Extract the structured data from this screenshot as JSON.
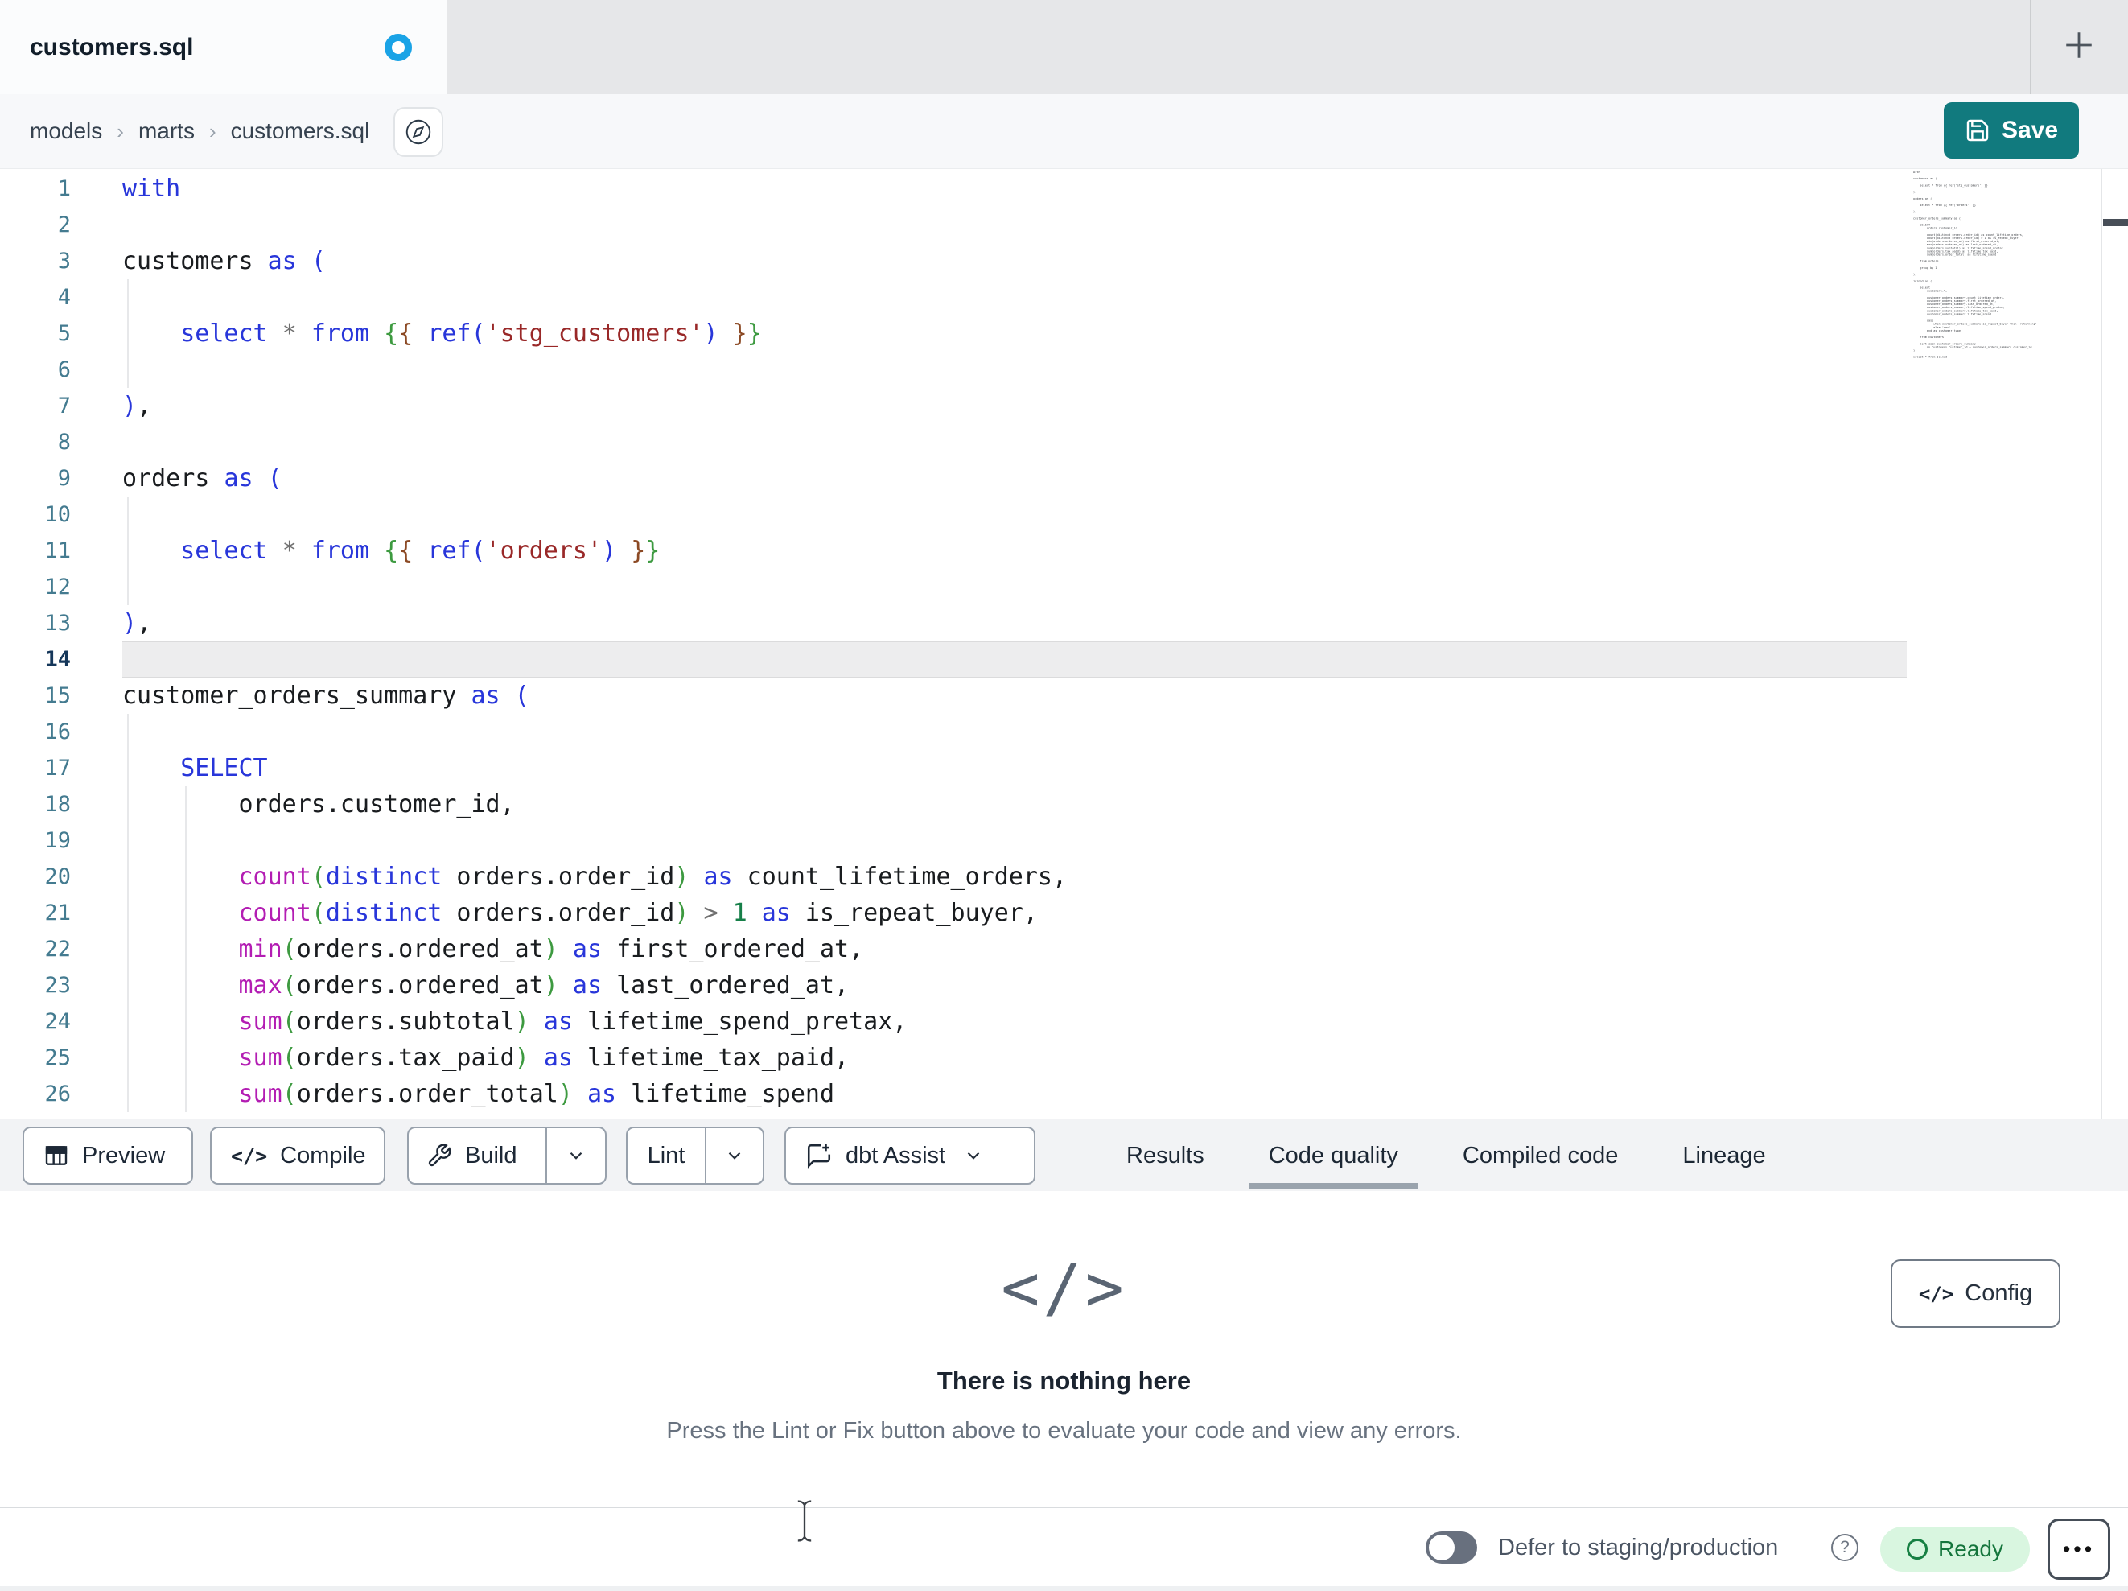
{
  "tabbar": {
    "tab_title": "customers.sql"
  },
  "breadcrumb": {
    "items": [
      "models",
      "marts",
      "customers.sql"
    ],
    "separator": "›"
  },
  "save": {
    "label": "Save"
  },
  "colors": {
    "save_teal": "#117a7e",
    "unsaved_dot_blue": "#1aa3e6",
    "ready_green_bg": "#d9f6e0",
    "ready_green_text": "#14753c",
    "keyword_blue": "#2836da",
    "function_magenta": "#b31db3",
    "string_red": "#992828",
    "active_tab_underline": "#9aa3ad"
  },
  "editor": {
    "active_line": 14,
    "lines": [
      {
        "no": 1,
        "tokens": [
          [
            "k",
            "with"
          ]
        ]
      },
      {
        "no": 2,
        "tokens": []
      },
      {
        "no": 3,
        "tokens": [
          [
            "p",
            "customers "
          ],
          [
            "k",
            "as"
          ],
          [
            "p",
            " "
          ],
          [
            "b1",
            "("
          ]
        ]
      },
      {
        "no": 4,
        "tokens": []
      },
      {
        "no": 5,
        "tokens": [
          [
            "p",
            "    "
          ],
          [
            "k",
            "select"
          ],
          [
            "p",
            " "
          ],
          [
            "o",
            "*"
          ],
          [
            "p",
            " "
          ],
          [
            "k",
            "from"
          ],
          [
            "p",
            " "
          ],
          [
            "b2",
            "{"
          ],
          [
            "b3",
            "{"
          ],
          [
            "p",
            " "
          ],
          [
            "k",
            "ref"
          ],
          [
            "b1",
            "("
          ],
          [
            "s",
            "'stg_customers'"
          ],
          [
            "b1",
            ")"
          ],
          [
            "p",
            " "
          ],
          [
            "b3",
            "}"
          ],
          [
            "b2",
            "}"
          ]
        ]
      },
      {
        "no": 6,
        "tokens": []
      },
      {
        "no": 7,
        "tokens": [
          [
            "b1",
            ")"
          ],
          [
            "p",
            ","
          ]
        ]
      },
      {
        "no": 8,
        "tokens": []
      },
      {
        "no": 9,
        "tokens": [
          [
            "p",
            "orders "
          ],
          [
            "k",
            "as"
          ],
          [
            "p",
            " "
          ],
          [
            "b1",
            "("
          ]
        ]
      },
      {
        "no": 10,
        "tokens": []
      },
      {
        "no": 11,
        "tokens": [
          [
            "p",
            "    "
          ],
          [
            "k",
            "select"
          ],
          [
            "p",
            " "
          ],
          [
            "o",
            "*"
          ],
          [
            "p",
            " "
          ],
          [
            "k",
            "from"
          ],
          [
            "p",
            " "
          ],
          [
            "b2",
            "{"
          ],
          [
            "b3",
            "{"
          ],
          [
            "p",
            " "
          ],
          [
            "k",
            "ref"
          ],
          [
            "b1",
            "("
          ],
          [
            "s",
            "'orders'"
          ],
          [
            "b1",
            ")"
          ],
          [
            "p",
            " "
          ],
          [
            "b3",
            "}"
          ],
          [
            "b2",
            "}"
          ]
        ]
      },
      {
        "no": 12,
        "tokens": []
      },
      {
        "no": 13,
        "tokens": [
          [
            "b1",
            ")"
          ],
          [
            "p",
            ","
          ]
        ]
      },
      {
        "no": 14,
        "tokens": []
      },
      {
        "no": 15,
        "tokens": [
          [
            "p",
            "customer_orders_summary "
          ],
          [
            "k",
            "as"
          ],
          [
            "p",
            " "
          ],
          [
            "b1",
            "("
          ]
        ]
      },
      {
        "no": 16,
        "tokens": []
      },
      {
        "no": 17,
        "tokens": [
          [
            "p",
            "    "
          ],
          [
            "k",
            "SELECT"
          ]
        ]
      },
      {
        "no": 18,
        "tokens": [
          [
            "p",
            "        orders.customer_id,"
          ]
        ]
      },
      {
        "no": 19,
        "tokens": []
      },
      {
        "no": 20,
        "tokens": [
          [
            "p",
            "        "
          ],
          [
            "f",
            "count"
          ],
          [
            "b2",
            "("
          ],
          [
            "k",
            "distinct"
          ],
          [
            "p",
            " orders.order_id"
          ],
          [
            "b2",
            ")"
          ],
          [
            "p",
            " "
          ],
          [
            "k",
            "as"
          ],
          [
            "p",
            " count_lifetime_orders,"
          ]
        ]
      },
      {
        "no": 21,
        "tokens": [
          [
            "p",
            "        "
          ],
          [
            "f",
            "count"
          ],
          [
            "b2",
            "("
          ],
          [
            "k",
            "distinct"
          ],
          [
            "p",
            " orders.order_id"
          ],
          [
            "b2",
            ")"
          ],
          [
            "p",
            " "
          ],
          [
            "o",
            ">"
          ],
          [
            "p",
            " "
          ],
          [
            "n",
            "1"
          ],
          [
            "p",
            " "
          ],
          [
            "k",
            "as"
          ],
          [
            "p",
            " is_repeat_buyer,"
          ]
        ]
      },
      {
        "no": 22,
        "tokens": [
          [
            "p",
            "        "
          ],
          [
            "f",
            "min"
          ],
          [
            "b2",
            "("
          ],
          [
            "p",
            "orders.ordered_at"
          ],
          [
            "b2",
            ")"
          ],
          [
            "p",
            " "
          ],
          [
            "k",
            "as"
          ],
          [
            "p",
            " first_ordered_at,"
          ]
        ]
      },
      {
        "no": 23,
        "tokens": [
          [
            "p",
            "        "
          ],
          [
            "f",
            "max"
          ],
          [
            "b2",
            "("
          ],
          [
            "p",
            "orders.ordered_at"
          ],
          [
            "b2",
            ")"
          ],
          [
            "p",
            " "
          ],
          [
            "k",
            "as"
          ],
          [
            "p",
            " last_ordered_at,"
          ]
        ]
      },
      {
        "no": 24,
        "tokens": [
          [
            "p",
            "        "
          ],
          [
            "f",
            "sum"
          ],
          [
            "b2",
            "("
          ],
          [
            "p",
            "orders.subtotal"
          ],
          [
            "b2",
            ")"
          ],
          [
            "p",
            " "
          ],
          [
            "k",
            "as"
          ],
          [
            "p",
            " lifetime_spend_pretax,"
          ]
        ]
      },
      {
        "no": 25,
        "tokens": [
          [
            "p",
            "        "
          ],
          [
            "f",
            "sum"
          ],
          [
            "b2",
            "("
          ],
          [
            "p",
            "orders.tax_paid"
          ],
          [
            "b2",
            ")"
          ],
          [
            "p",
            " "
          ],
          [
            "k",
            "as"
          ],
          [
            "p",
            " lifetime_tax_paid,"
          ]
        ]
      },
      {
        "no": 26,
        "tokens": [
          [
            "p",
            "        "
          ],
          [
            "f",
            "sum"
          ],
          [
            "b2",
            "("
          ],
          [
            "p",
            "orders.order_total"
          ],
          [
            "b2",
            ")"
          ],
          [
            "p",
            " "
          ],
          [
            "k",
            "as"
          ],
          [
            "p",
            " lifetime_spend"
          ]
        ]
      }
    ]
  },
  "minimap": {
    "lines": [
      "with",
      "",
      "customers as (",
      "",
      "    select * from {{ ref('stg_customers') }}",
      "",
      "),",
      "",
      "orders as (",
      "",
      "    select * from {{ ref('orders') }}",
      "",
      "),",
      "",
      "customer_orders_summary as (",
      "",
      "    SELECT",
      "        orders.customer_id,",
      "",
      "        count(distinct orders.order_id) as count_lifetime_orders,",
      "        count(distinct orders.order_id) > 1 as is_repeat_buyer,",
      "        min(orders.ordered_at) as first_ordered_at,",
      "        max(orders.ordered_at) as last_ordered_at,",
      "        sum(orders.subtotal) as lifetime_spend_pretax,",
      "        sum(orders.tax_paid) as lifetime_tax_paid,",
      "        sum(orders.order_total) as lifetime_spend",
      "",
      "    from orders",
      "",
      "    group by 1",
      "",
      "),",
      "",
      "joined as (",
      "",
      "    select",
      "        customers.*,",
      "",
      "        customer_orders_summary.count_lifetime_orders,",
      "        customer_orders_summary.first_ordered_at,",
      "        customer_orders_summary.last_ordered_at,",
      "        customer_orders_summary.lifetime_spend_pretax,",
      "        customer_orders_summary.lifetime_tax_paid,",
      "        customer_orders_summary.lifetime_spend,",
      "",
      "        case",
      "            when customer_orders_summary.is_repeat_buyer then 'returning'",
      "            else 'new'",
      "        end as customer_type",
      "",
      "    from customers",
      "",
      "    left join customer_orders_summary",
      "        on customers.customer_id = customer_orders_summary.customer_id",
      ")",
      "",
      "select * from joined"
    ]
  },
  "toolbar": {
    "preview": "Preview",
    "compile": "Compile",
    "build": "Build",
    "lint": "Lint",
    "assist": "dbt Assist",
    "code_glyph": "</>"
  },
  "tabs": {
    "items": [
      "Results",
      "Code quality",
      "Compiled code",
      "Lineage"
    ],
    "active": "Code quality"
  },
  "empty_state": {
    "icon": "</>",
    "title": "There is nothing here",
    "subtitle": "Press the Lint or Fix button above to evaluate your code and view any errors."
  },
  "config": {
    "label": "Config",
    "icon": "</>"
  },
  "statusbar": {
    "defer_label": "Defer to staging/production",
    "help_glyph": "?",
    "ready_label": "Ready",
    "menu": "•••"
  }
}
